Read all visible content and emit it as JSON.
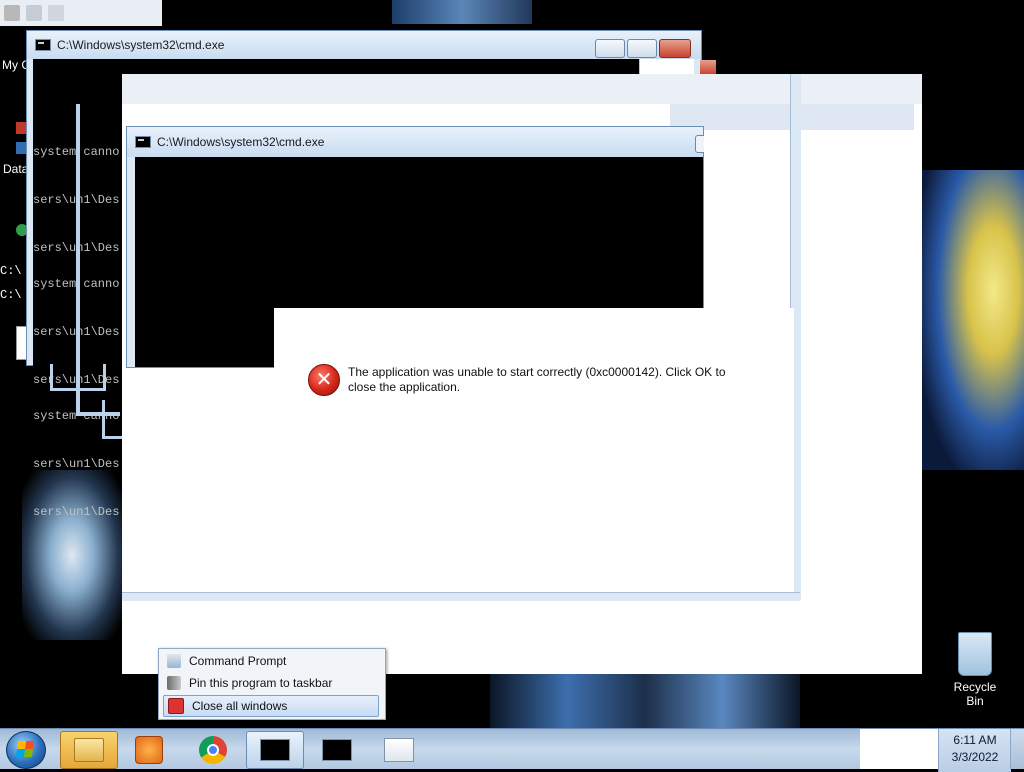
{
  "desktop": {
    "left_labels": [
      "My C",
      "Data",
      "C:\\",
      "C:\\"
    ],
    "recycle_bin_label": "Recycle Bin"
  },
  "window_back": {
    "title": "C:\\Windows\\system32\\cmd.exe",
    "console_lines": [
      "system canno",
      "sers\\un1\\Des",
      "sers\\un1\\Des",
      "system canno",
      "sers\\un1\\Des",
      "sers\\un1\\Des",
      "system canno",
      "sers\\un1\\Des",
      "sers\\un1\\Des"
    ]
  },
  "window_front": {
    "title": "C:\\Windows\\system32\\cmd.exe"
  },
  "error_dialog": {
    "message": "The application was unable to start correctly (0xc0000142). Click OK to close the application."
  },
  "jump_list": {
    "items": [
      {
        "label": "Command Prompt",
        "icon": "command-prompt-icon"
      },
      {
        "label": "Pin this program to taskbar",
        "icon": "pin-icon"
      },
      {
        "label": "Close all windows",
        "icon": "close-windows-icon"
      }
    ],
    "selected_index": 2
  },
  "taskbar": {
    "buttons": [
      {
        "name": "windows-explorer",
        "icon": "folder-icon"
      },
      {
        "name": "media-player",
        "icon": "media-player-icon"
      },
      {
        "name": "chrome",
        "icon": "chrome-icon"
      },
      {
        "name": "cmd-1",
        "icon": "cmd-icon",
        "active": true
      },
      {
        "name": "cmd-2",
        "icon": "cmd-icon"
      },
      {
        "name": "app-window",
        "icon": "window-icon"
      }
    ],
    "clock_time": "6:11 AM",
    "clock_date": "3/3/2022"
  }
}
